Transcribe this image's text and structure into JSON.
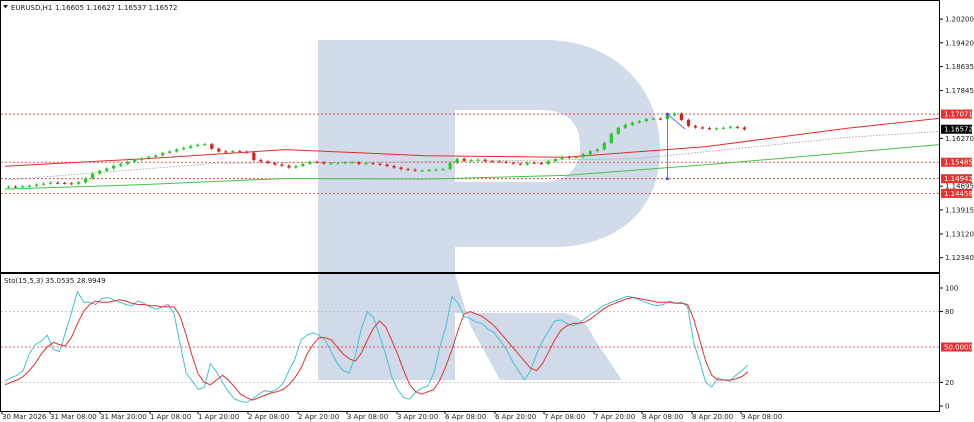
{
  "symbol_label": "EURUSD,H1",
  "ohlc_label": "1.16605 1.16627 1.16537 1.16572",
  "oscillator_label": "Sto(15,5,3) 35.0535 28.9949",
  "colors": {
    "bull": "#22cc22",
    "bear": "#e01e1e",
    "ma_red": "#e52b2b",
    "ma_green": "#49c24a",
    "stoch_main": "#46c2cf",
    "stoch_signal": "#e53232",
    "level_line": "#e53232",
    "watermark": "#cfd9e8",
    "marker": "#4a54e0"
  },
  "chart_data": [
    {
      "type": "candlestick",
      "title": "EURUSD,H1",
      "y_ticks": [
        "1.20200",
        "1.19420",
        "1.18635",
        "1.17845",
        "1.16270",
        "1.14695",
        "1.13915",
        "1.13120",
        "1.12340"
      ],
      "ylim": [
        1.12,
        1.205
      ],
      "x_ticks": [
        "30 Mar 2026",
        "31 Mar 08:00",
        "31 Mar 20:00",
        "1 Apr 08:00",
        "1 Apr 20:00",
        "2 Apr 08:00",
        "2 Apr 20:00",
        "3 Apr 08:00",
        "3 Apr 20:00",
        "6 Apr 08:00",
        "6 Apr 20:00",
        "7 Apr 08:00",
        "7 Apr 20:00",
        "8 Apr 08:00",
        "8 Apr 20:00",
        "9 Apr 08:00"
      ],
      "closes": [
        1.1468,
        1.1467,
        1.1469,
        1.1471,
        1.1475,
        1.1478,
        1.1481,
        1.148,
        1.1479,
        1.1477,
        1.1482,
        1.1495,
        1.1511,
        1.152,
        1.1528,
        1.1537,
        1.1543,
        1.155,
        1.1556,
        1.1561,
        1.1566,
        1.1571,
        1.1579,
        1.1584,
        1.1591,
        1.1596,
        1.1602,
        1.1606,
        1.1608,
        1.1593,
        1.1584,
        1.1581,
        1.1585,
        1.1583,
        1.158,
        1.1556,
        1.1551,
        1.1546,
        1.1541,
        1.1537,
        1.1531,
        1.1536,
        1.1543,
        1.155,
        1.1548,
        1.1544,
        1.1545,
        1.1545,
        1.1548,
        1.1548,
        1.1543,
        1.1545,
        1.1543,
        1.1541,
        1.1536,
        1.1531,
        1.1526,
        1.1524,
        1.1521,
        1.1521,
        1.1523,
        1.1524,
        1.1526,
        1.1546,
        1.156,
        1.1553,
        1.1556,
        1.1557,
        1.1552,
        1.1551,
        1.155,
        1.1547,
        1.1544,
        1.1541,
        1.1547,
        1.1546,
        1.1543,
        1.1552,
        1.1559,
        1.1566,
        1.1564,
        1.1566,
        1.1575,
        1.1585,
        1.1591,
        1.1612,
        1.1642,
        1.1662,
        1.1672,
        1.1679,
        1.1684,
        1.1691,
        1.1692,
        1.1691,
        1.1703,
        1.1709,
        1.1688,
        1.1668,
        1.1663,
        1.1661,
        1.1658,
        1.166,
        1.1662,
        1.1665,
        1.1663,
        1.1657
      ],
      "levels": [
        {
          "price": 1.17071,
          "label": "1.17071"
        },
        {
          "price": 1.15485,
          "label": "1.15485"
        },
        {
          "price": 1.14942,
          "label": "1.14942"
        },
        {
          "price": 1.14458,
          "label": "1.14458"
        }
      ],
      "current_price": {
        "price": 1.16572,
        "label": "1.16572"
      },
      "moving_averages": [
        {
          "color": "red",
          "points": [
            [
              0,
              1.1535
            ],
            [
              20,
              1.156
            ],
            [
              40,
              1.159
            ],
            [
              60,
              1.157
            ],
            [
              80,
              1.1565
            ],
            [
              100,
              1.16
            ],
            [
              120,
              1.166
            ],
            [
              140,
              1.171
            ]
          ]
        },
        {
          "color": "green",
          "points": [
            [
              0,
              1.146
            ],
            [
              20,
              1.1475
            ],
            [
              40,
              1.1495
            ],
            [
              60,
              1.1493
            ],
            [
              80,
              1.1505
            ],
            [
              100,
              1.154
            ],
            [
              120,
              1.158
            ],
            [
              140,
              1.162
            ]
          ]
        },
        {
          "color": "gray",
          "points": [
            [
              0,
              1.149
            ],
            [
              30,
              1.1545
            ],
            [
              60,
              1.155
            ],
            [
              90,
              1.156
            ],
            [
              120,
              1.163
            ],
            [
              140,
              1.166
            ]
          ]
        }
      ],
      "forecast": {
        "from": 1.17071,
        "to": 1.14942,
        "target": 1.16572
      }
    },
    {
      "type": "line",
      "title": "Sto(15,5,3) 35.0535 28.9949",
      "y_ticks": [
        "100",
        "80",
        "50.0000",
        "20",
        "0"
      ],
      "ylim": [
        0,
        100
      ],
      "levels": [
        80,
        50,
        20
      ],
      "series": [
        {
          "name": "main",
          "values": [
            21,
            24,
            26,
            30,
            44,
            52,
            55,
            60,
            48,
            46,
            62,
            79,
            97,
            88,
            88,
            86,
            91,
            92,
            90,
            88,
            86,
            85,
            89,
            87,
            84,
            82,
            84,
            86,
            78,
            52,
            28,
            21,
            14,
            16,
            36,
            29,
            20,
            12,
            6,
            4,
            3,
            6,
            10,
            13,
            12,
            14,
            19,
            30,
            40,
            56,
            60,
            62,
            60,
            56,
            46,
            36,
            30,
            28,
            43,
            66,
            80,
            75,
            60,
            44,
            25,
            14,
            7,
            6,
            12,
            15,
            17,
            28,
            50,
            68,
            93,
            87,
            76,
            74,
            71,
            70,
            65,
            62,
            55,
            48,
            38,
            30,
            22,
            30,
            44,
            55,
            64,
            72,
            73,
            70,
            68,
            70,
            74,
            78,
            81,
            85,
            87,
            89,
            91,
            93,
            92,
            90,
            88,
            86,
            85,
            86,
            89,
            87,
            88,
            84,
            54,
            38,
            20,
            16,
            24,
            22,
            21,
            26,
            30,
            35
          ]
        },
        {
          "name": "signal",
          "values": [
            18,
            20,
            22,
            25,
            30,
            36,
            44,
            50,
            54,
            52,
            51,
            58,
            70,
            80,
            86,
            89,
            88,
            88,
            89,
            90,
            89,
            87,
            86,
            86,
            85,
            85,
            84,
            84,
            84,
            76,
            60,
            42,
            27,
            20,
            18,
            22,
            26,
            22,
            16,
            10,
            7,
            5,
            7,
            9,
            11,
            12,
            14,
            18,
            24,
            32,
            44,
            52,
            58,
            58,
            56,
            50,
            44,
            40,
            38,
            45,
            56,
            66,
            72,
            67,
            56,
            44,
            30,
            18,
            12,
            10,
            12,
            14,
            22,
            34,
            48,
            64,
            78,
            80,
            78,
            76,
            72,
            68,
            62,
            56,
            50,
            44,
            38,
            32,
            30,
            36,
            46,
            56,
            64,
            68,
            70,
            70,
            71,
            74,
            78,
            82,
            85,
            87,
            89,
            91,
            92,
            91,
            90,
            89,
            88,
            88,
            88,
            87,
            87,
            86,
            74,
            56,
            38,
            26,
            22,
            22,
            22,
            23,
            25,
            29
          ]
        }
      ]
    }
  ]
}
